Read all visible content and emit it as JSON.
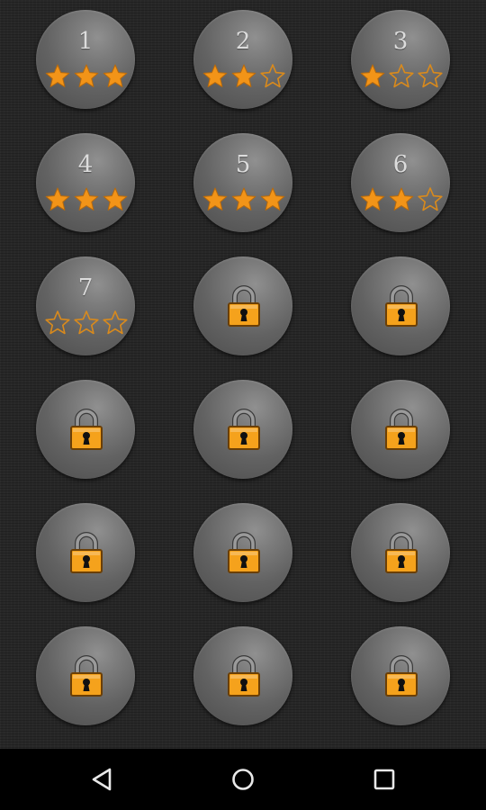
{
  "colors": {
    "star_fill": "#f29418",
    "star_outline": "#d98a1c",
    "lock_body": "#f5a21c",
    "lock_shackle": "#9a9a9a",
    "keyhole": "#111111",
    "nav_icon": "#e8e8e8"
  },
  "levels": [
    {
      "number": "1",
      "locked": false,
      "stars": 3
    },
    {
      "number": "2",
      "locked": false,
      "stars": 2
    },
    {
      "number": "3",
      "locked": false,
      "stars": 1
    },
    {
      "number": "4",
      "locked": false,
      "stars": 3
    },
    {
      "number": "5",
      "locked": false,
      "stars": 3
    },
    {
      "number": "6",
      "locked": false,
      "stars": 2
    },
    {
      "number": "7",
      "locked": false,
      "stars": 0
    },
    {
      "locked": true
    },
    {
      "locked": true
    },
    {
      "locked": true
    },
    {
      "locked": true
    },
    {
      "locked": true
    },
    {
      "locked": true
    },
    {
      "locked": true
    },
    {
      "locked": true
    },
    {
      "locked": true
    },
    {
      "locked": true
    },
    {
      "locked": true
    }
  ],
  "nav": {
    "back_icon": "back-triangle-icon",
    "home_icon": "home-circle-icon",
    "recents_icon": "recents-square-icon"
  }
}
